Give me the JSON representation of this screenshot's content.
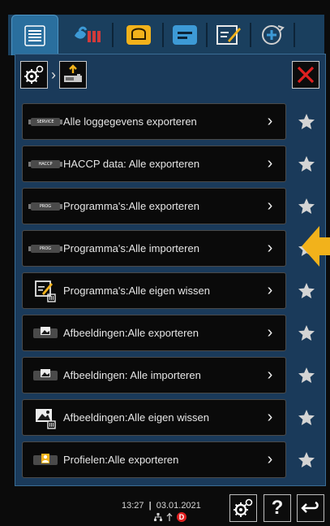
{
  "tabs": [
    {
      "name": "menu-list-icon",
      "active": true
    },
    {
      "name": "steam-cooking-icon",
      "active": false
    },
    {
      "name": "bread-icon",
      "active": false
    },
    {
      "name": "recipe-list-icon",
      "active": false
    },
    {
      "name": "edit-icon",
      "active": false
    },
    {
      "name": "rotation-plus-icon",
      "active": false
    }
  ],
  "breadcrumb": {
    "settings_icon": "gear-icon",
    "current_icon": "usb-export-icon"
  },
  "items": [
    {
      "label": "Alle loggegevens exporteren",
      "badge": "SERVICE",
      "icon": "usb-badge-icon"
    },
    {
      "label": "HACCP data:  Alle exporteren",
      "badge": "HACCP",
      "icon": "usb-badge-icon"
    },
    {
      "label": "Programma's:Alle exporteren",
      "badge": "PROG",
      "icon": "usb-badge-icon"
    },
    {
      "label": "Programma's:Alle importeren",
      "badge": "PROG",
      "icon": "usb-badge-icon"
    },
    {
      "label": "Programma's:Alle eigen wissen",
      "badge": "",
      "icon": "edit-delete-icon"
    },
    {
      "label": "Afbeeldingen:Alle exporteren",
      "badge": "",
      "icon": "image-usb-icon"
    },
    {
      "label": "Afbeeldingen: Alle importeren",
      "badge": "",
      "icon": "image-usb-icon"
    },
    {
      "label": "Afbeeldingen:Alle eigen wissen",
      "badge": "",
      "icon": "image-delete-icon"
    },
    {
      "label": "Profielen:Alle exporteren",
      "badge": "",
      "icon": "profile-usb-icon"
    }
  ],
  "status": {
    "time": "13:27",
    "date": "03.01.2021",
    "separator": "|",
    "error_badge": "D"
  },
  "colors": {
    "accent": "#f2b21b",
    "panel": "#1a3a5a",
    "close": "#e02020"
  }
}
